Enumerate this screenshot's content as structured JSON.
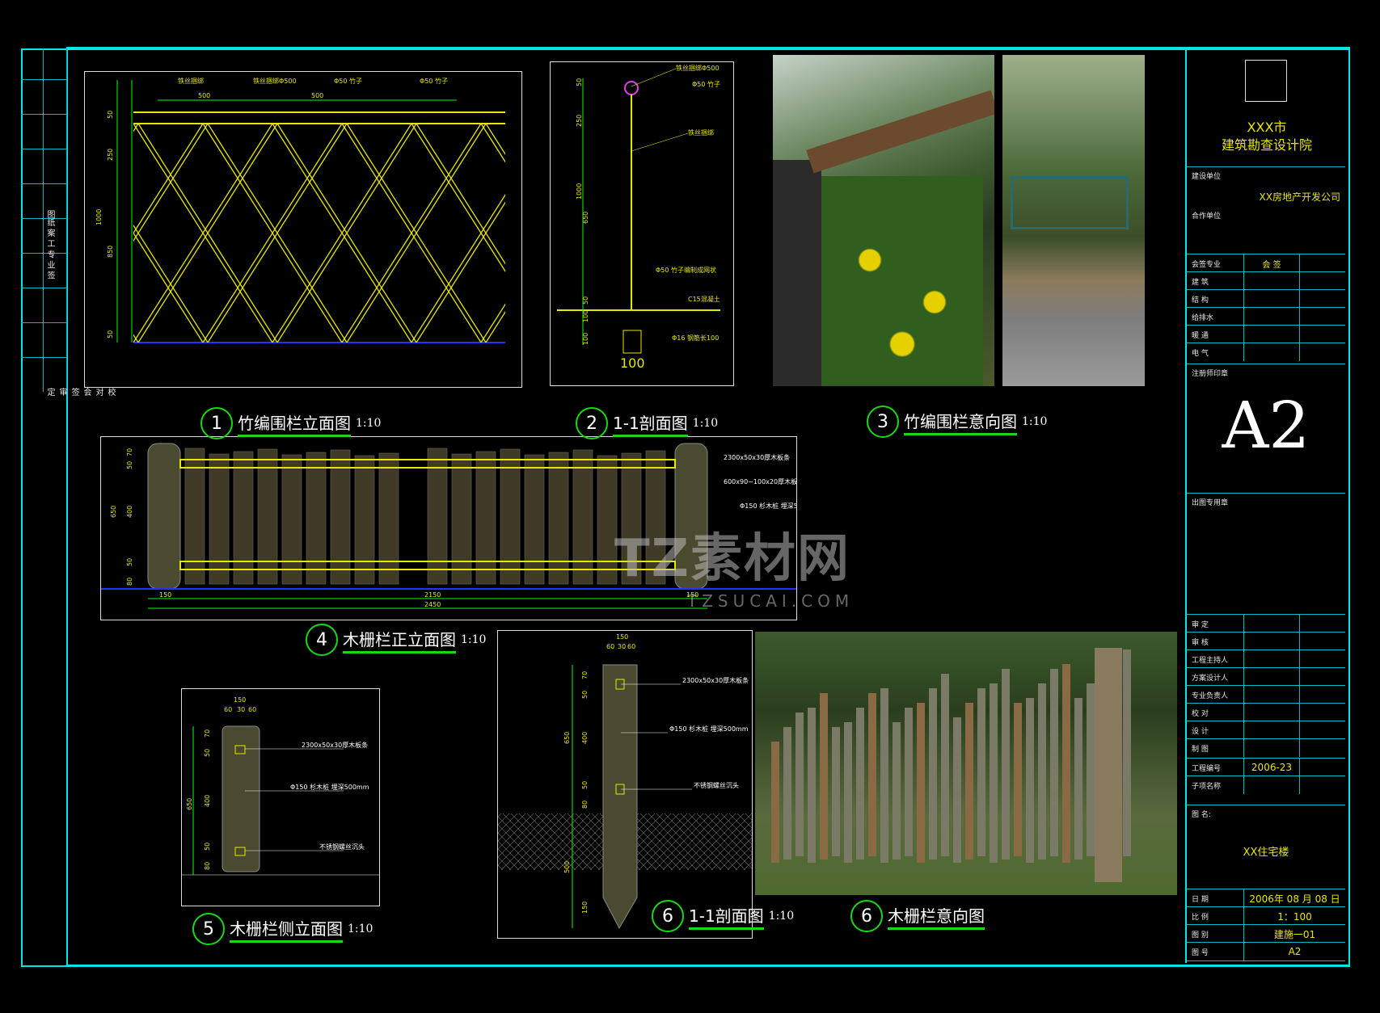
{
  "captions": [
    {
      "num": "1",
      "title": "竹编围栏立面图",
      "scale": "1:10"
    },
    {
      "num": "2",
      "title": "1-1剖面图",
      "scale": "1:10"
    },
    {
      "num": "3",
      "title": "竹编围栏意向图",
      "scale": "1:10"
    },
    {
      "num": "4",
      "title": "木栅栏正立面图",
      "scale": "1:10"
    },
    {
      "num": "5",
      "title": "木栅栏侧立面图",
      "scale": "1:10"
    },
    {
      "num": "6",
      "title": "1-1剖面图",
      "scale": "1:10"
    },
    {
      "num": "6",
      "title": "木栅栏意向图",
      "scale": ""
    }
  ],
  "drawing1": {
    "labels": [
      "铁丝捆绑",
      "铁丝捆绑Φ500",
      "Φ50 竹子",
      "Φ50 竹子"
    ],
    "dims_top": [
      "500",
      "500"
    ],
    "dims_left": [
      "50",
      "250",
      "1000",
      "850",
      "50"
    ]
  },
  "drawing2": {
    "labels": [
      "铁丝捆绑Φ500",
      "Φ50 竹子",
      "铁丝捆绑",
      "Φ50 竹子编制成网状",
      "C15混凝土",
      "Φ16 钢筋长100"
    ],
    "dims": [
      "50",
      "250",
      "1000",
      "650",
      "50",
      "100",
      "100"
    ],
    "bottom": "100"
  },
  "drawing4": {
    "labels": [
      "2300x50x30厚木板条",
      "600x90~100x20厚木板条",
      "Φ150 杉木桩 埋深500mm"
    ],
    "dims_left": [
      "650",
      "70",
      "50",
      "400",
      "50",
      "80"
    ],
    "dims_bottom": [
      "150",
      "2150",
      "150",
      "2450"
    ]
  },
  "drawing5": {
    "labels": [
      "2300x50x30厚木板条",
      "Φ150 杉木桩 埋深500mm",
      "不锈钢螺丝沉头"
    ],
    "top": [
      "150",
      "60",
      "30",
      "60"
    ],
    "dims_left": [
      "650",
      "70",
      "50",
      "400",
      "50",
      "80"
    ]
  },
  "drawing6": {
    "labels": [
      "2300x50x30厚木板条",
      "Φ150 杉木桩 埋深500mm",
      "不锈钢螺丝沉头"
    ],
    "top": [
      "150",
      "60",
      "30",
      "60"
    ],
    "dims_left": [
      "650",
      "70",
      "50",
      "400",
      "50",
      "80",
      "500",
      "150"
    ]
  },
  "watermark": {
    "main": "TZ素材网",
    "sub": "TZSUCAI.COM"
  },
  "left_strip": {
    "top": "图纸 案 工 专 业 签",
    "bottom": "校对 会签 审定"
  },
  "title_block": {
    "institute_line1": "XXX市",
    "institute_line2": "建筑勘查设计院",
    "client_label": "建设单位",
    "client_value": "XX房地产开发公司",
    "partner_label": "合作单位",
    "countersign_header": [
      "会签专业",
      "会 签"
    ],
    "countersign_rows": [
      "建 筑",
      "结 构",
      "给排水",
      "暖 通",
      "电 气"
    ],
    "stamp_label": "注册师印章",
    "sheet_size": "A2",
    "seal_label": "出图专用章",
    "staff_rows": [
      "审 定",
      "审 核",
      "工程主持人",
      "方案设计人",
      "专业负责人",
      "校 对",
      "设 计",
      "制 图"
    ],
    "project_no_label": "工程编号",
    "project_no": "2006-23",
    "sub_item_label": "子项名称",
    "drawing_name_label": "图 名:",
    "drawing_name": "XX住宅楼",
    "date_label": "日 期",
    "date": "2006年 08 月 08 日",
    "scale_label": "比 例",
    "scale": "1：100",
    "sheet_label": "图 别",
    "sheet": "建施一01",
    "number_label": "图 号",
    "number": "A2"
  },
  "colors": {
    "frame": "#00e5e5",
    "cad": "#e6e600",
    "green": "#18d818",
    "dim": "#00ff00",
    "blue": "#2233ff"
  }
}
